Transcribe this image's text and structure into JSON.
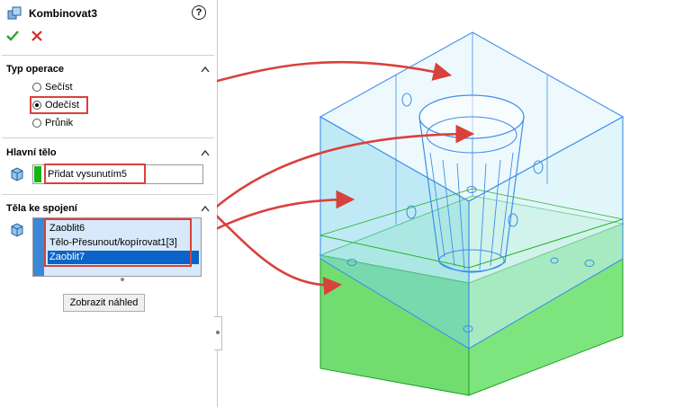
{
  "panel": {
    "title": "Kombinovat3",
    "help_glyph": "?",
    "ok_icon": "check-icon",
    "cancel_icon": "close-icon"
  },
  "operation_type": {
    "title": "Typ operace",
    "options": [
      {
        "label": "Sečíst",
        "checked": false
      },
      {
        "label": "Odečíst",
        "checked": true
      },
      {
        "label": "Průnik",
        "checked": false
      }
    ]
  },
  "main_body": {
    "title": "Hlavní tělo",
    "value": "Přidat vysunutím5",
    "color": "#17b417"
  },
  "bodies_to_combine": {
    "title": "Těla ke spojení",
    "items": [
      {
        "label": "Zaoblit6",
        "selected": false
      },
      {
        "label": "Tělo-Přesunout/kopírovat1[3]",
        "selected": false
      },
      {
        "label": "Zaoblit7",
        "selected": true
      }
    ],
    "color": "#3b88d8"
  },
  "preview_button": "Zobrazit náhled",
  "colors": {
    "highlight_red": "#d9413c",
    "tool_body_blue": "#4aa3ee",
    "main_body_green": "#21c021",
    "selection_blue": "#0b63c7"
  }
}
